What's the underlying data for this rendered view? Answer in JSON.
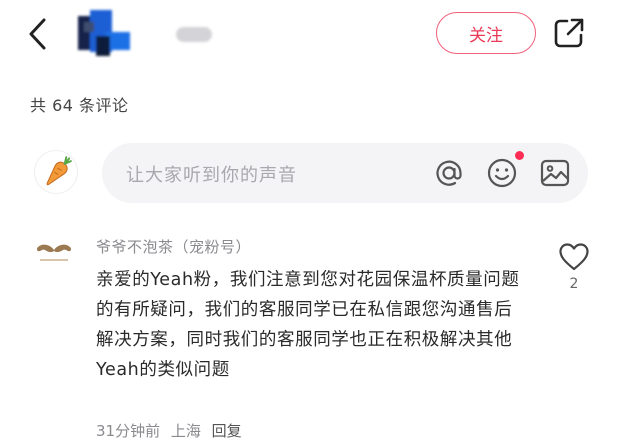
{
  "header": {
    "follow_label": "关注"
  },
  "comments_header": {
    "count_text": "共 64 条评论"
  },
  "composer": {
    "placeholder": "让大家听到你的声音"
  },
  "comment": {
    "author": "爷爷不泡茶（宠粉号）",
    "body": "亲爱的Yeah粉，我们注意到您对花园保温杯质量问题的有所疑问，我们的客服同学已在私信跟您沟通售后解决方案，同时我们的客服同学也正在积极解决其他Yeah的类似问题",
    "time": "31分钟前",
    "location": "上海",
    "reply_label": "回复",
    "like_count": "2"
  },
  "icons": {
    "back": "chevron-left-icon",
    "share": "share-external-icon",
    "mention": "at-sign-icon",
    "emoji": "smiley-icon",
    "image": "image-icon",
    "like": "heart-outline-icon"
  },
  "colors": {
    "accent": "#ea3a57",
    "notification_dot": "#ff2d55",
    "input_bg": "#f4f4f6",
    "muted_text": "#8a8a8f"
  }
}
